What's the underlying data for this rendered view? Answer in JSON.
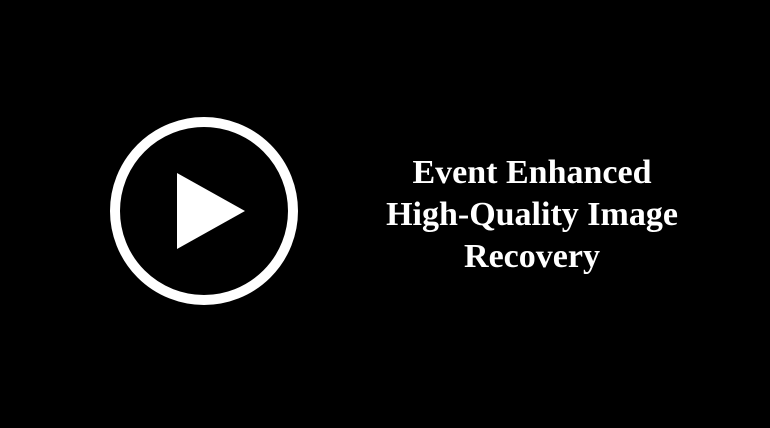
{
  "video": {
    "title_lines": [
      "Event Enhanced",
      "High-Quality Image",
      "Recovery"
    ]
  },
  "colors": {
    "background": "#000000",
    "foreground": "#ffffff"
  },
  "icons": {
    "play": "play-icon"
  }
}
